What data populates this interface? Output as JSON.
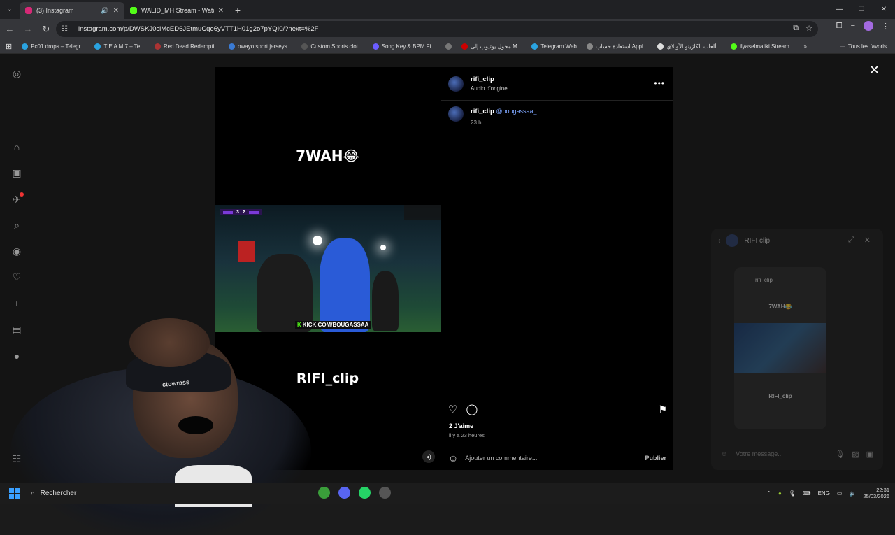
{
  "browser": {
    "tabs": [
      {
        "title": "(3) Instagram",
        "color": "#d62976",
        "active": true
      },
      {
        "title": "WALID_MH Stream - Watch Live",
        "color": "#53fc18",
        "active": false
      }
    ],
    "url": "instagram.com/p/DWSKJ0ciMcED6JEtmuCqe6yVTT1H01g2o7pYQI0/?next=%2F",
    "bookmarks": [
      "Pc01 drops – Telegr...",
      "T E A M 7 – Te...",
      "Red Dead Redempti...",
      "owayo sport jerseys...",
      "Custom Sports clot...",
      "Song Key & BPM Fi...",
      "محول يوتيوب إلى M...",
      "Telegram Web",
      "استعادة حساب Appl...",
      "ألعاب الكازينو الأونلاي...",
      "ilyaselmaliki Stream..."
    ],
    "bookmarks_all": "Tous les favoris"
  },
  "post": {
    "overlay_top": "7WAH😂",
    "overlay_bottom": "RIFI_clip",
    "video": {
      "score_a": "3",
      "score_b": "2",
      "kick_label": "KICK.COM/BOUGASSAA"
    },
    "author": "rifi_clip",
    "audio": "Audio d'origine",
    "caption_user": "rifi_clip",
    "caption_mention": "@bougassaa_",
    "caption_time": "23 h",
    "likes": "2 J'aime",
    "posted_ago": "il y a 23 heures",
    "comment_placeholder": "Ajouter un commentaire...",
    "publish_label": "Publier"
  },
  "chat": {
    "title": "RIFI clip",
    "card_user": "rifi_clip",
    "card_top": "7WAH😂",
    "card_bottom": "RIFI_clip",
    "input_placeholder": "Votre message..."
  },
  "webcam": {
    "cap_text": "ctowrass"
  },
  "taskbar": {
    "search": "Rechercher",
    "lang": "ENG",
    "time": "22:31",
    "date": "25/03/2026"
  },
  "colors": {
    "accent": "#0095f6",
    "kick": "#53fc18",
    "instagram": "#d62976"
  }
}
